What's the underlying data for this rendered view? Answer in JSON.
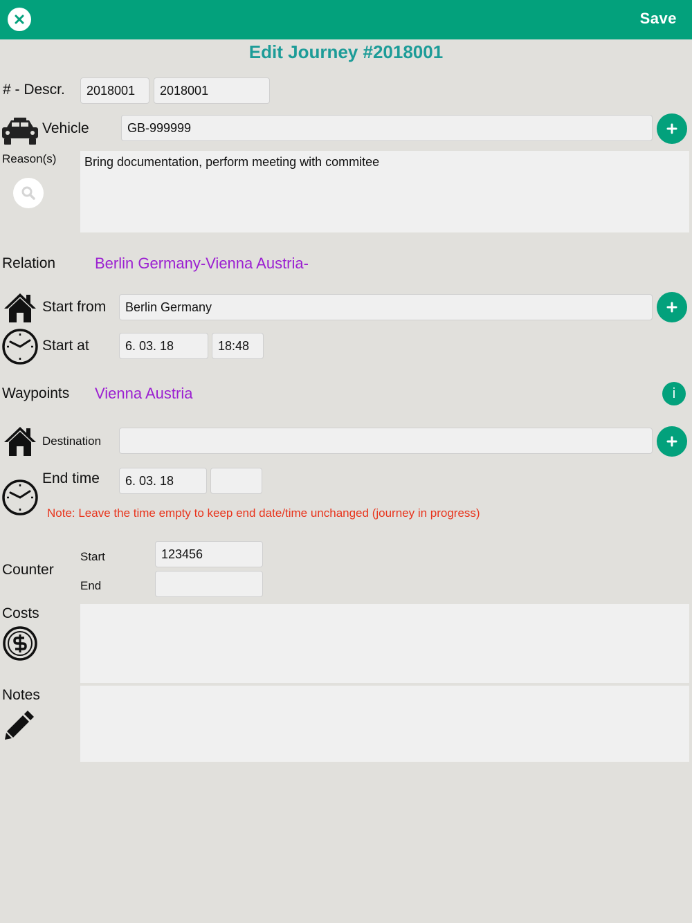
{
  "header": {
    "save_label": "Save"
  },
  "title": "Edit Journey #2018001",
  "number_descr": {
    "label": "# - Descr.",
    "number_value": "2018001",
    "descr_value": "2018001"
  },
  "vehicle": {
    "label": "Vehicle",
    "value": "GB-999999"
  },
  "reasons": {
    "label": "Reason(s)",
    "value": "Bring documentation, perform meeting with commitee"
  },
  "relation": {
    "label": "Relation",
    "value": "Berlin Germany-Vienna Austria-"
  },
  "start_from": {
    "label": "Start from",
    "value": "Berlin Germany"
  },
  "start_at": {
    "label": "Start at",
    "date": "6. 03. 18",
    "time": "18:48"
  },
  "waypoints": {
    "label": "Waypoints",
    "value": "Vienna Austria",
    "info_label": "i"
  },
  "destination": {
    "label": "Destination",
    "value": ""
  },
  "end_time": {
    "label": "End time",
    "date": "6. 03. 18",
    "time": "",
    "note": "Note: Leave the time empty to keep end date/time unchanged (journey in progress)"
  },
  "counter": {
    "label": "Counter",
    "start_label": "Start",
    "start_value": "123456",
    "end_label": "End",
    "end_value": ""
  },
  "costs": {
    "label": "Costs",
    "value": ""
  },
  "notes": {
    "label": "Notes",
    "value": ""
  },
  "colors": {
    "accent": "#03a17c",
    "title": "#1d9c98",
    "relation": "#9b1fd1",
    "note": "#e8341c",
    "background": "#e1e0dc"
  },
  "icons": [
    "close-icon",
    "car-icon",
    "search-icon",
    "plus-icon",
    "house-icon",
    "clock-icon",
    "info-icon",
    "dollar-icon",
    "pencil-icon"
  ]
}
